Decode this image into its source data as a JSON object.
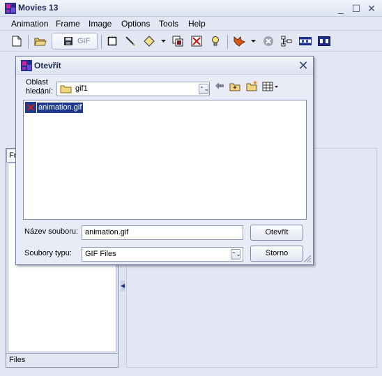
{
  "window": {
    "title": "Movies 13",
    "minimize": "_",
    "maximize": "☐",
    "close": "✕"
  },
  "menu": {
    "items": [
      {
        "label": "Animation"
      },
      {
        "label": "Frame"
      },
      {
        "label": "Image"
      },
      {
        "label": "Options"
      },
      {
        "label": "Tools"
      },
      {
        "label": "Help"
      }
    ]
  },
  "toolbar": {
    "gif_label": "GIF",
    "icons": [
      "new-file-icon",
      "open-folder-icon",
      "save-gif-icon",
      "rectangle-icon",
      "pencil-icon",
      "diamond-icon",
      "dropdown-arrow-icon",
      "copy-frames-icon",
      "delete-frame-icon",
      "light-bulb-icon",
      "fox-icon",
      "dropdown-arrow-icon",
      "stop-icon",
      "tree-icon",
      "filmstrip-icon",
      "filmstrip-dark-icon"
    ]
  },
  "left_panel": {
    "tab_label": "Fr",
    "footer_label": "Files"
  },
  "dialog": {
    "title": "Otevřít",
    "lookin_label": "Oblast hledání:",
    "lookin_value": "gif1",
    "files": [
      {
        "name": "animation.gif",
        "selected": true
      }
    ],
    "filename_label": "Název souboru:",
    "filename_value": "animation.gif",
    "filetype_label": "Soubory typu:",
    "filetype_value": "GIF Files",
    "open_button": "Otevřít",
    "cancel_button": "Storno"
  },
  "colors": {
    "accent": "#1f3a8c",
    "window_bg": "#e3e7f4"
  }
}
